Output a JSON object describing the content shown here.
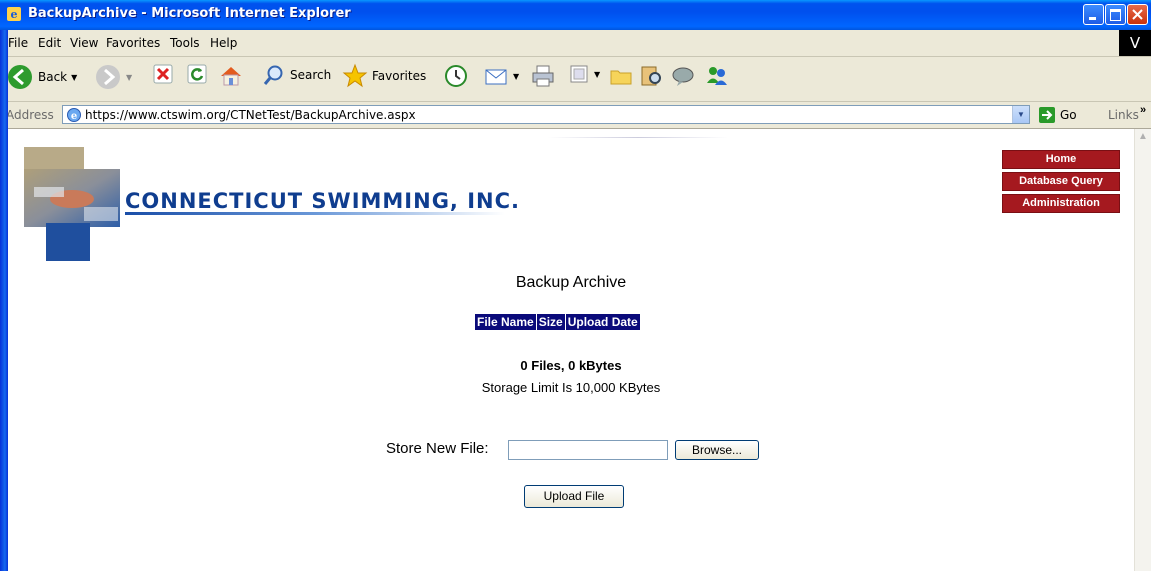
{
  "window": {
    "title": "BackupArchive - Microsoft Internet Explorer"
  },
  "menu": {
    "items": [
      "File",
      "Edit",
      "View",
      "Favorites",
      "Tools",
      "Help"
    ],
    "logo": "V"
  },
  "toolbar": {
    "back_label": "Back",
    "search_label": "Search",
    "favorites_label": "Favorites"
  },
  "address": {
    "label": "Address",
    "url": "https://www.ctswim.org/CTNetTest/BackupArchive.aspx",
    "go_label": "Go",
    "links_label": "Links"
  },
  "site": {
    "logo_title": "CONNECTICUT SWIMMING, INC.",
    "nav": [
      "Home",
      "Database Query",
      "Administration"
    ]
  },
  "page": {
    "title": "Backup Archive",
    "table_headers": [
      "File Name",
      "Size",
      "Upload Date"
    ],
    "summary": "0 Files, 0 kBytes",
    "limit": "Storage Limit Is 10,000 KBytes",
    "store_label": "Store New File:",
    "browse_label": "Browse...",
    "upload_label": "Upload File"
  },
  "colors": {
    "nav_bg": "#a5191f",
    "table_header_bg": "#0a0a7a",
    "logo_text": "#0f3d8f"
  }
}
